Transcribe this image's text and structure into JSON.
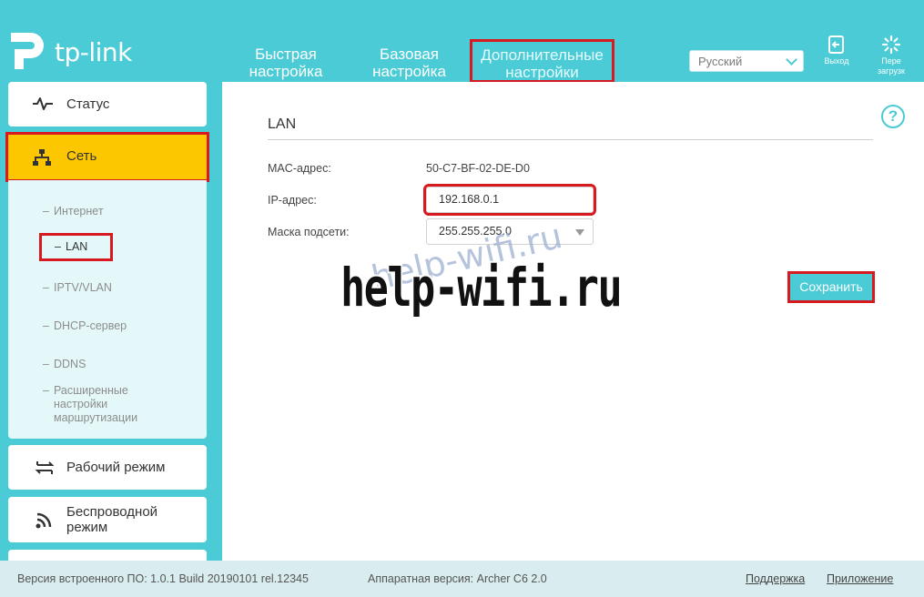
{
  "brand": {
    "name": "tp-link"
  },
  "nav": {
    "tabs": [
      {
        "line1": "Быстрая",
        "line2": "настройка"
      },
      {
        "line1": "Базовая",
        "line2": "настройка"
      },
      {
        "line1": "Дополнительные",
        "line2": "настройки"
      }
    ]
  },
  "language": {
    "selected": "Русский"
  },
  "header_buttons": {
    "logout": "Выход",
    "reboot_line1": "Пере",
    "reboot_line2": "загрузк"
  },
  "sidebar": {
    "status": "Статус",
    "network": "Сеть",
    "network_sub": [
      {
        "label": "Интернет"
      },
      {
        "label": "LAN"
      },
      {
        "label": "IPTV/VLAN"
      },
      {
        "label": "DHCP-сервер"
      },
      {
        "label": "DDNS"
      },
      {
        "label": "Расширенные настройки маршрутизации"
      }
    ],
    "work_mode": "Рабочий режим",
    "wireless_line1": "Беспроводной",
    "wireless_line2": "режим"
  },
  "content": {
    "title": "LAN",
    "help_symbol": "?",
    "mac_label": "MAC-адрес:",
    "mac_value": "50-C7-BF-02-DE-D0",
    "ip_label": "IP-адрес:",
    "ip_value": "192.168.0.1",
    "mask_label": "Маска подсети:",
    "mask_value": "255.255.255.0",
    "save": "Сохранить"
  },
  "watermark": {
    "text": "help-wifi.ru"
  },
  "footer": {
    "firmware": "Версия встроенного ПО: 1.0.1 Build 20190101 rel.12345",
    "hardware": "Аппаратная версия: Archer C6 2.0",
    "support": "Поддержка",
    "app": "Приложение"
  },
  "colors": {
    "accent": "#4acbd6",
    "active_menu": "#fdc700",
    "highlight": "#d71920"
  }
}
